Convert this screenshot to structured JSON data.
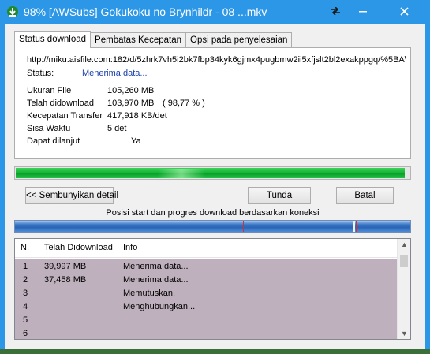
{
  "window": {
    "title": "98% [AWSubs] Gokukoku no Brynhildr - 08 ...mkv",
    "accent": "#2c97e6"
  },
  "tabs": [
    "Status download",
    "Pembatas Kecepatan",
    "Opsi pada penyelesaian"
  ],
  "status": {
    "url": "http://miku.aisfile.com:182/d/5zhrk7vh5i2bk7fbp34kyk6gjmx4pugbmw2ii5xfjslt2bl2exakppgq/%5BA\\",
    "status_label": "Status:",
    "status_value": "Menerima data...",
    "rows": [
      {
        "label": "Ukuran File",
        "value": "105,260  MB",
        "extra": ""
      },
      {
        "label": "Telah didownload",
        "value": "103,970  MB",
        "extra": "( 98,77 % )"
      },
      {
        "label": "Kecepatan Transfer",
        "value": "417,918  KB/det",
        "extra": ""
      },
      {
        "label": "Sisa Waktu",
        "value": "5 det",
        "extra": ""
      },
      {
        "label": "Dapat dilanjut",
        "value": "",
        "extra": "Ya"
      }
    ]
  },
  "progress": {
    "fraction": 0.9877,
    "color": "#16b636"
  },
  "buttons": {
    "hide_details": "<< Sembunyikan detail",
    "pause": "Tunda",
    "cancel": "Batal"
  },
  "connection": {
    "caption": "Posisi start dan progres download berdasarkan koneksi"
  },
  "list": {
    "columns": [
      "N.",
      "Telah Didownload",
      "Info"
    ],
    "rows": [
      {
        "n": "1",
        "downloaded": "39,997  MB",
        "info": "Menerima data..."
      },
      {
        "n": "2",
        "downloaded": "37,458  MB",
        "info": "Menerima data..."
      },
      {
        "n": "3",
        "downloaded": "",
        "info": "Memutuskan."
      },
      {
        "n": "4",
        "downloaded": "",
        "info": "Menghubungkan..."
      },
      {
        "n": "5",
        "downloaded": "",
        "info": ""
      },
      {
        "n": "6",
        "downloaded": "",
        "info": ""
      }
    ],
    "row_bg": "#beb0bc"
  }
}
